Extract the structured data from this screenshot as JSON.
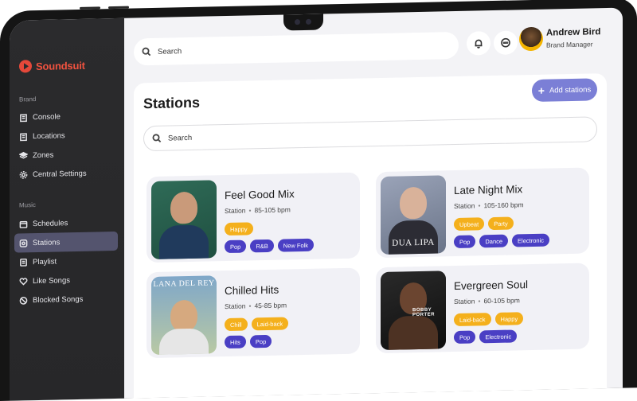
{
  "app": {
    "brand": "Soundsuit"
  },
  "sidebar": {
    "brand_section": "Brand",
    "brand_items": [
      {
        "label": "Console",
        "icon": "building-icon"
      },
      {
        "label": "Locations",
        "icon": "building-icon"
      },
      {
        "label": "Zones",
        "icon": "layers-icon"
      },
      {
        "label": "Central Settings",
        "icon": "gear-icon"
      }
    ],
    "music_section": "Music",
    "music_items": [
      {
        "label": "Schedules",
        "icon": "calendar-icon"
      },
      {
        "label": "Stations",
        "icon": "radio-icon",
        "active": true
      },
      {
        "label": "Playlist",
        "icon": "list-icon"
      },
      {
        "label": "Like Songs",
        "icon": "heart-icon"
      },
      {
        "label": "Blocked Songs",
        "icon": "block-icon"
      }
    ]
  },
  "header": {
    "search_placeholder": "Search",
    "user_name": "Andrew Bird",
    "user_role": "Brand Manager"
  },
  "main": {
    "title": "Stations",
    "add_label": "Add stations",
    "search_placeholder": "Search",
    "stations": [
      {
        "name": "Feel Good Mix",
        "type": "Station",
        "bpm": "85-105 bpm",
        "moods": [
          "Happy"
        ],
        "genres": [
          "Pop",
          "R&B",
          "New Folk"
        ]
      },
      {
        "name": "Late Night Mix",
        "type": "Station",
        "bpm": "105-160 bpm",
        "cover_text": "DUA LIPA",
        "moods": [
          "Upbeat",
          "Party"
        ],
        "genres": [
          "Pop",
          "Dance",
          "Electronic"
        ]
      },
      {
        "name": "Chilled Hits",
        "type": "Station",
        "bpm": "45-85 bpm",
        "cover_text": "LANA DEL REY",
        "moods": [
          "Chill",
          "Laid-back"
        ],
        "genres": [
          "Hits",
          "Pop"
        ]
      },
      {
        "name": "Evergreen Soul",
        "type": "Station",
        "bpm": "60-105 bpm",
        "cover_text": "BOBBY PORTER",
        "moods": [
          "Laid-back",
          "Happy"
        ],
        "genres": [
          "Pop",
          "Electronic"
        ]
      }
    ]
  },
  "colors": {
    "brand": "#f0523f",
    "accent": "#7b7fd6",
    "mood_tag": "#f4b01c",
    "genre_tag": "#4a3fc4",
    "sidebar_bg": "#2b2b2d"
  }
}
